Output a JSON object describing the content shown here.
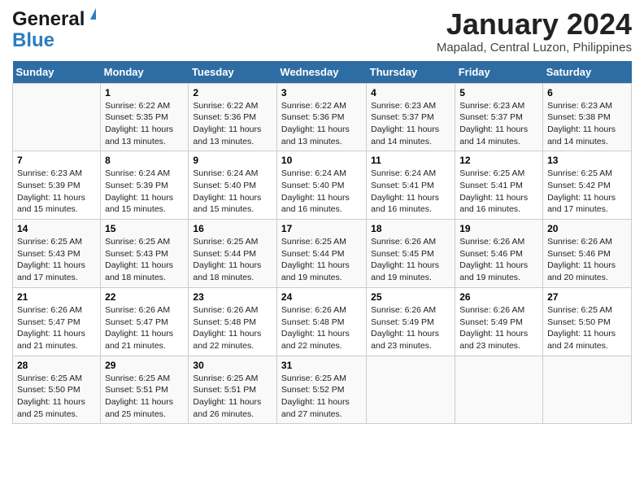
{
  "header": {
    "logo_line1": "General",
    "logo_line2": "Blue",
    "month": "January 2024",
    "location": "Mapalad, Central Luzon, Philippines"
  },
  "weekdays": [
    "Sunday",
    "Monday",
    "Tuesday",
    "Wednesday",
    "Thursday",
    "Friday",
    "Saturday"
  ],
  "weeks": [
    [
      {
        "day": null,
        "info": null
      },
      {
        "day": "1",
        "info": "Sunrise: 6:22 AM\nSunset: 5:35 PM\nDaylight: 11 hours and 13 minutes."
      },
      {
        "day": "2",
        "info": "Sunrise: 6:22 AM\nSunset: 5:36 PM\nDaylight: 11 hours and 13 minutes."
      },
      {
        "day": "3",
        "info": "Sunrise: 6:22 AM\nSunset: 5:36 PM\nDaylight: 11 hours and 13 minutes."
      },
      {
        "day": "4",
        "info": "Sunrise: 6:23 AM\nSunset: 5:37 PM\nDaylight: 11 hours and 14 minutes."
      },
      {
        "day": "5",
        "info": "Sunrise: 6:23 AM\nSunset: 5:37 PM\nDaylight: 11 hours and 14 minutes."
      },
      {
        "day": "6",
        "info": "Sunrise: 6:23 AM\nSunset: 5:38 PM\nDaylight: 11 hours and 14 minutes."
      }
    ],
    [
      {
        "day": "7",
        "info": "Sunrise: 6:23 AM\nSunset: 5:39 PM\nDaylight: 11 hours and 15 minutes."
      },
      {
        "day": "8",
        "info": "Sunrise: 6:24 AM\nSunset: 5:39 PM\nDaylight: 11 hours and 15 minutes."
      },
      {
        "day": "9",
        "info": "Sunrise: 6:24 AM\nSunset: 5:40 PM\nDaylight: 11 hours and 15 minutes."
      },
      {
        "day": "10",
        "info": "Sunrise: 6:24 AM\nSunset: 5:40 PM\nDaylight: 11 hours and 16 minutes."
      },
      {
        "day": "11",
        "info": "Sunrise: 6:24 AM\nSunset: 5:41 PM\nDaylight: 11 hours and 16 minutes."
      },
      {
        "day": "12",
        "info": "Sunrise: 6:25 AM\nSunset: 5:41 PM\nDaylight: 11 hours and 16 minutes."
      },
      {
        "day": "13",
        "info": "Sunrise: 6:25 AM\nSunset: 5:42 PM\nDaylight: 11 hours and 17 minutes."
      }
    ],
    [
      {
        "day": "14",
        "info": "Sunrise: 6:25 AM\nSunset: 5:43 PM\nDaylight: 11 hours and 17 minutes."
      },
      {
        "day": "15",
        "info": "Sunrise: 6:25 AM\nSunset: 5:43 PM\nDaylight: 11 hours and 18 minutes."
      },
      {
        "day": "16",
        "info": "Sunrise: 6:25 AM\nSunset: 5:44 PM\nDaylight: 11 hours and 18 minutes."
      },
      {
        "day": "17",
        "info": "Sunrise: 6:25 AM\nSunset: 5:44 PM\nDaylight: 11 hours and 19 minutes."
      },
      {
        "day": "18",
        "info": "Sunrise: 6:26 AM\nSunset: 5:45 PM\nDaylight: 11 hours and 19 minutes."
      },
      {
        "day": "19",
        "info": "Sunrise: 6:26 AM\nSunset: 5:46 PM\nDaylight: 11 hours and 19 minutes."
      },
      {
        "day": "20",
        "info": "Sunrise: 6:26 AM\nSunset: 5:46 PM\nDaylight: 11 hours and 20 minutes."
      }
    ],
    [
      {
        "day": "21",
        "info": "Sunrise: 6:26 AM\nSunset: 5:47 PM\nDaylight: 11 hours and 21 minutes."
      },
      {
        "day": "22",
        "info": "Sunrise: 6:26 AM\nSunset: 5:47 PM\nDaylight: 11 hours and 21 minutes."
      },
      {
        "day": "23",
        "info": "Sunrise: 6:26 AM\nSunset: 5:48 PM\nDaylight: 11 hours and 22 minutes."
      },
      {
        "day": "24",
        "info": "Sunrise: 6:26 AM\nSunset: 5:48 PM\nDaylight: 11 hours and 22 minutes."
      },
      {
        "day": "25",
        "info": "Sunrise: 6:26 AM\nSunset: 5:49 PM\nDaylight: 11 hours and 23 minutes."
      },
      {
        "day": "26",
        "info": "Sunrise: 6:26 AM\nSunset: 5:49 PM\nDaylight: 11 hours and 23 minutes."
      },
      {
        "day": "27",
        "info": "Sunrise: 6:25 AM\nSunset: 5:50 PM\nDaylight: 11 hours and 24 minutes."
      }
    ],
    [
      {
        "day": "28",
        "info": "Sunrise: 6:25 AM\nSunset: 5:50 PM\nDaylight: 11 hours and 25 minutes."
      },
      {
        "day": "29",
        "info": "Sunrise: 6:25 AM\nSunset: 5:51 PM\nDaylight: 11 hours and 25 minutes."
      },
      {
        "day": "30",
        "info": "Sunrise: 6:25 AM\nSunset: 5:51 PM\nDaylight: 11 hours and 26 minutes."
      },
      {
        "day": "31",
        "info": "Sunrise: 6:25 AM\nSunset: 5:52 PM\nDaylight: 11 hours and 27 minutes."
      },
      {
        "day": null,
        "info": null
      },
      {
        "day": null,
        "info": null
      },
      {
        "day": null,
        "info": null
      }
    ]
  ]
}
